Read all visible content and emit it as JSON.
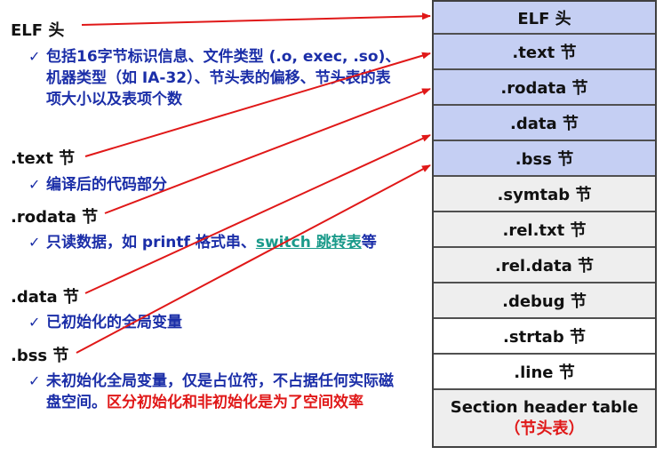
{
  "left": {
    "elf_header": {
      "title": "ELF 头",
      "desc": "包括16字节标识信息、文件类型 (.o, exec, .so)、机器类型（如 IA-32）、节头表的偏移、节头表的表项大小以及表项个数"
    },
    "text": {
      "title": ".text 节",
      "desc": "编译后的代码部分"
    },
    "rodata": {
      "title": ".rodata 节",
      "desc_pre": "只读数据，如 printf 格式串、",
      "desc_link": "switch 跳转表",
      "desc_post": "等"
    },
    "data": {
      "title": ".data 节",
      "desc": "已初始化的全局变量"
    },
    "bss": {
      "title": ".bss 节",
      "desc_pre": "未初始化全局变量，仅是占位符，不占据任何实际磁盘空间。",
      "desc_emph": "区分初始化和非初始化是为了空间效率"
    },
    "check_glyph": "✓"
  },
  "table": {
    "rows": [
      {
        "label": "ELF 头"
      },
      {
        "label": ".text 节"
      },
      {
        "label": ".rodata 节"
      },
      {
        "label": ".data 节"
      },
      {
        "label": ".bss 节"
      },
      {
        "label": ".symtab 节"
      },
      {
        "label": ".rel.txt 节"
      },
      {
        "label": ".rel.data 节"
      },
      {
        "label": ".debug 节"
      },
      {
        "label": ".strtab 节"
      },
      {
        "label": ".line 节"
      }
    ],
    "last_row": {
      "label": "Section header table",
      "sublabel": "（节头表）"
    }
  },
  "colors": {
    "arrow": "#e01818",
    "header_blue": "#c5cff3",
    "section_gray": "#eeeeee",
    "desc_blue": "#1b2ea8"
  }
}
